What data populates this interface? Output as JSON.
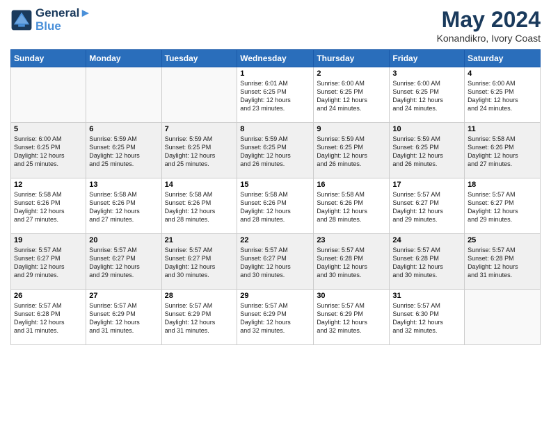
{
  "header": {
    "logo_line1": "General",
    "logo_line2": "Blue",
    "title": "May 2024",
    "subtitle": "Konandikro, Ivory Coast"
  },
  "weekdays": [
    "Sunday",
    "Monday",
    "Tuesday",
    "Wednesday",
    "Thursday",
    "Friday",
    "Saturday"
  ],
  "weeks": [
    [
      {
        "day": "",
        "info": ""
      },
      {
        "day": "",
        "info": ""
      },
      {
        "day": "",
        "info": ""
      },
      {
        "day": "1",
        "info": "Sunrise: 6:01 AM\nSunset: 6:25 PM\nDaylight: 12 hours\nand 23 minutes."
      },
      {
        "day": "2",
        "info": "Sunrise: 6:00 AM\nSunset: 6:25 PM\nDaylight: 12 hours\nand 24 minutes."
      },
      {
        "day": "3",
        "info": "Sunrise: 6:00 AM\nSunset: 6:25 PM\nDaylight: 12 hours\nand 24 minutes."
      },
      {
        "day": "4",
        "info": "Sunrise: 6:00 AM\nSunset: 6:25 PM\nDaylight: 12 hours\nand 24 minutes."
      }
    ],
    [
      {
        "day": "5",
        "info": "Sunrise: 6:00 AM\nSunset: 6:25 PM\nDaylight: 12 hours\nand 25 minutes."
      },
      {
        "day": "6",
        "info": "Sunrise: 5:59 AM\nSunset: 6:25 PM\nDaylight: 12 hours\nand 25 minutes."
      },
      {
        "day": "7",
        "info": "Sunrise: 5:59 AM\nSunset: 6:25 PM\nDaylight: 12 hours\nand 25 minutes."
      },
      {
        "day": "8",
        "info": "Sunrise: 5:59 AM\nSunset: 6:25 PM\nDaylight: 12 hours\nand 26 minutes."
      },
      {
        "day": "9",
        "info": "Sunrise: 5:59 AM\nSunset: 6:25 PM\nDaylight: 12 hours\nand 26 minutes."
      },
      {
        "day": "10",
        "info": "Sunrise: 5:59 AM\nSunset: 6:25 PM\nDaylight: 12 hours\nand 26 minutes."
      },
      {
        "day": "11",
        "info": "Sunrise: 5:58 AM\nSunset: 6:26 PM\nDaylight: 12 hours\nand 27 minutes."
      }
    ],
    [
      {
        "day": "12",
        "info": "Sunrise: 5:58 AM\nSunset: 6:26 PM\nDaylight: 12 hours\nand 27 minutes."
      },
      {
        "day": "13",
        "info": "Sunrise: 5:58 AM\nSunset: 6:26 PM\nDaylight: 12 hours\nand 27 minutes."
      },
      {
        "day": "14",
        "info": "Sunrise: 5:58 AM\nSunset: 6:26 PM\nDaylight: 12 hours\nand 28 minutes."
      },
      {
        "day": "15",
        "info": "Sunrise: 5:58 AM\nSunset: 6:26 PM\nDaylight: 12 hours\nand 28 minutes."
      },
      {
        "day": "16",
        "info": "Sunrise: 5:58 AM\nSunset: 6:26 PM\nDaylight: 12 hours\nand 28 minutes."
      },
      {
        "day": "17",
        "info": "Sunrise: 5:57 AM\nSunset: 6:27 PM\nDaylight: 12 hours\nand 29 minutes."
      },
      {
        "day": "18",
        "info": "Sunrise: 5:57 AM\nSunset: 6:27 PM\nDaylight: 12 hours\nand 29 minutes."
      }
    ],
    [
      {
        "day": "19",
        "info": "Sunrise: 5:57 AM\nSunset: 6:27 PM\nDaylight: 12 hours\nand 29 minutes."
      },
      {
        "day": "20",
        "info": "Sunrise: 5:57 AM\nSunset: 6:27 PM\nDaylight: 12 hours\nand 29 minutes."
      },
      {
        "day": "21",
        "info": "Sunrise: 5:57 AM\nSunset: 6:27 PM\nDaylight: 12 hours\nand 30 minutes."
      },
      {
        "day": "22",
        "info": "Sunrise: 5:57 AM\nSunset: 6:27 PM\nDaylight: 12 hours\nand 30 minutes."
      },
      {
        "day": "23",
        "info": "Sunrise: 5:57 AM\nSunset: 6:28 PM\nDaylight: 12 hours\nand 30 minutes."
      },
      {
        "day": "24",
        "info": "Sunrise: 5:57 AM\nSunset: 6:28 PM\nDaylight: 12 hours\nand 30 minutes."
      },
      {
        "day": "25",
        "info": "Sunrise: 5:57 AM\nSunset: 6:28 PM\nDaylight: 12 hours\nand 31 minutes."
      }
    ],
    [
      {
        "day": "26",
        "info": "Sunrise: 5:57 AM\nSunset: 6:28 PM\nDaylight: 12 hours\nand 31 minutes."
      },
      {
        "day": "27",
        "info": "Sunrise: 5:57 AM\nSunset: 6:29 PM\nDaylight: 12 hours\nand 31 minutes."
      },
      {
        "day": "28",
        "info": "Sunrise: 5:57 AM\nSunset: 6:29 PM\nDaylight: 12 hours\nand 31 minutes."
      },
      {
        "day": "29",
        "info": "Sunrise: 5:57 AM\nSunset: 6:29 PM\nDaylight: 12 hours\nand 32 minutes."
      },
      {
        "day": "30",
        "info": "Sunrise: 5:57 AM\nSunset: 6:29 PM\nDaylight: 12 hours\nand 32 minutes."
      },
      {
        "day": "31",
        "info": "Sunrise: 5:57 AM\nSunset: 6:30 PM\nDaylight: 12 hours\nand 32 minutes."
      },
      {
        "day": "",
        "info": ""
      }
    ]
  ]
}
